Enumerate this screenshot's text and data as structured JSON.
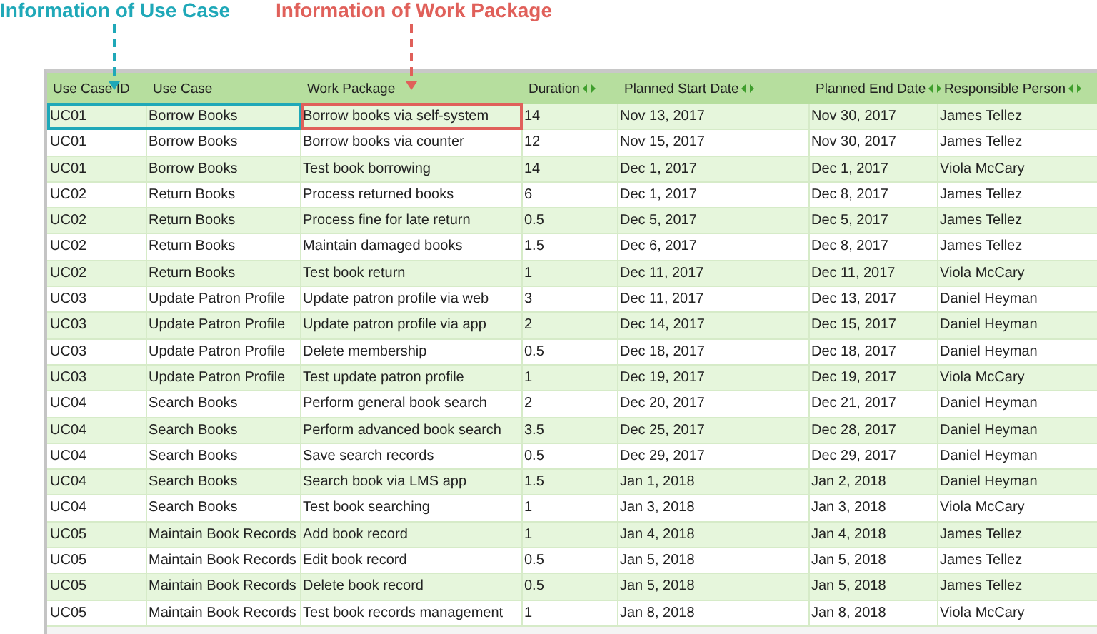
{
  "annotations": [
    {
      "kind": "use-case",
      "label": "Information of Use Case",
      "color": "#1fa8b8"
    },
    {
      "kind": "work-package",
      "label": "Information of Work Package",
      "color": "#e0605a"
    }
  ],
  "table": {
    "columns": [
      {
        "label": "Use Case ID",
        "sortable": false
      },
      {
        "label": "Use Case",
        "sortable": false
      },
      {
        "label": "Work Package",
        "sortable": false
      },
      {
        "label": "Duration",
        "sortable": true
      },
      {
        "label": "Planned Start Date",
        "sortable": true
      },
      {
        "label": "Planned End Date",
        "sortable": true
      },
      {
        "label": "Responsible Person",
        "sortable": true
      }
    ],
    "rows": [
      [
        "UC01",
        "Borrow Books",
        "Borrow books via self-system",
        "14",
        "Nov 13, 2017",
        "Nov 30, 2017",
        "James Tellez"
      ],
      [
        "UC01",
        "Borrow Books",
        "Borrow books via counter",
        "12",
        "Nov 15, 2017",
        "Nov 30, 2017",
        "James Tellez"
      ],
      [
        "UC01",
        "Borrow Books",
        "Test book borrowing",
        "14",
        "Dec 1, 2017",
        "Dec 1, 2017",
        "Viola McCary"
      ],
      [
        "UC02",
        "Return Books",
        "Process returned books",
        "6",
        "Dec 1, 2017",
        "Dec 8, 2017",
        "James Tellez"
      ],
      [
        "UC02",
        "Return Books",
        "Process fine for late return",
        "0.5",
        "Dec 5, 2017",
        "Dec 5, 2017",
        "James Tellez"
      ],
      [
        "UC02",
        "Return Books",
        "Maintain damaged books",
        "1.5",
        "Dec 6, 2017",
        "Dec 8, 2017",
        "James Tellez"
      ],
      [
        "UC02",
        "Return Books",
        "Test book return",
        "1",
        "Dec 11, 2017",
        "Dec 11, 2017",
        "Viola McCary"
      ],
      [
        "UC03",
        "Update Patron Profile",
        "Update patron profile via web",
        "3",
        "Dec 11, 2017",
        "Dec 13, 2017",
        "Daniel Heyman"
      ],
      [
        "UC03",
        "Update Patron Profile",
        "Update patron profile via app",
        "2",
        "Dec 14, 2017",
        "Dec 15, 2017",
        "Daniel Heyman"
      ],
      [
        "UC03",
        "Update Patron Profile",
        "Delete membership",
        "0.5",
        "Dec 18, 2017",
        "Dec 18, 2017",
        "Daniel Heyman"
      ],
      [
        "UC03",
        "Update Patron Profile",
        "Test update patron profile",
        "1",
        "Dec 19, 2017",
        "Dec 19, 2017",
        "Viola McCary"
      ],
      [
        "UC04",
        "Search Books",
        "Perform general book search",
        "2",
        "Dec 20, 2017",
        "Dec 21, 2017",
        "Daniel Heyman"
      ],
      [
        "UC04",
        "Search Books",
        "Perform advanced book search",
        "3.5",
        "Dec 25, 2017",
        "Dec 28, 2017",
        "Daniel Heyman"
      ],
      [
        "UC04",
        "Search Books",
        "Save search records",
        "0.5",
        "Dec 29, 2017",
        "Dec 29, 2017",
        "Daniel Heyman"
      ],
      [
        "UC04",
        "Search Books",
        "Search book via LMS app",
        "1.5",
        "Jan 1, 2018",
        "Jan 2, 2018",
        "Daniel Heyman"
      ],
      [
        "UC04",
        "Search Books",
        "Test book searching",
        "1",
        "Jan 3, 2018",
        "Jan 3, 2018",
        "Viola McCary"
      ],
      [
        "UC05",
        "Maintain Book Records",
        "Add book record",
        "1",
        "Jan 4, 2018",
        "Jan 4, 2018",
        "James Tellez"
      ],
      [
        "UC05",
        "Maintain Book Records",
        "Edit book record",
        "0.5",
        "Jan 5, 2018",
        "Jan 5, 2018",
        "James Tellez"
      ],
      [
        "UC05",
        "Maintain Book Records",
        "Delete book record",
        "0.5",
        "Jan 5, 2018",
        "Jan 5, 2018",
        "James Tellez"
      ],
      [
        "UC05",
        "Maintain Book Records",
        "Test book records management",
        "1",
        "Jan 8, 2018",
        "Jan 8, 2018",
        "Viola McCary"
      ]
    ]
  }
}
